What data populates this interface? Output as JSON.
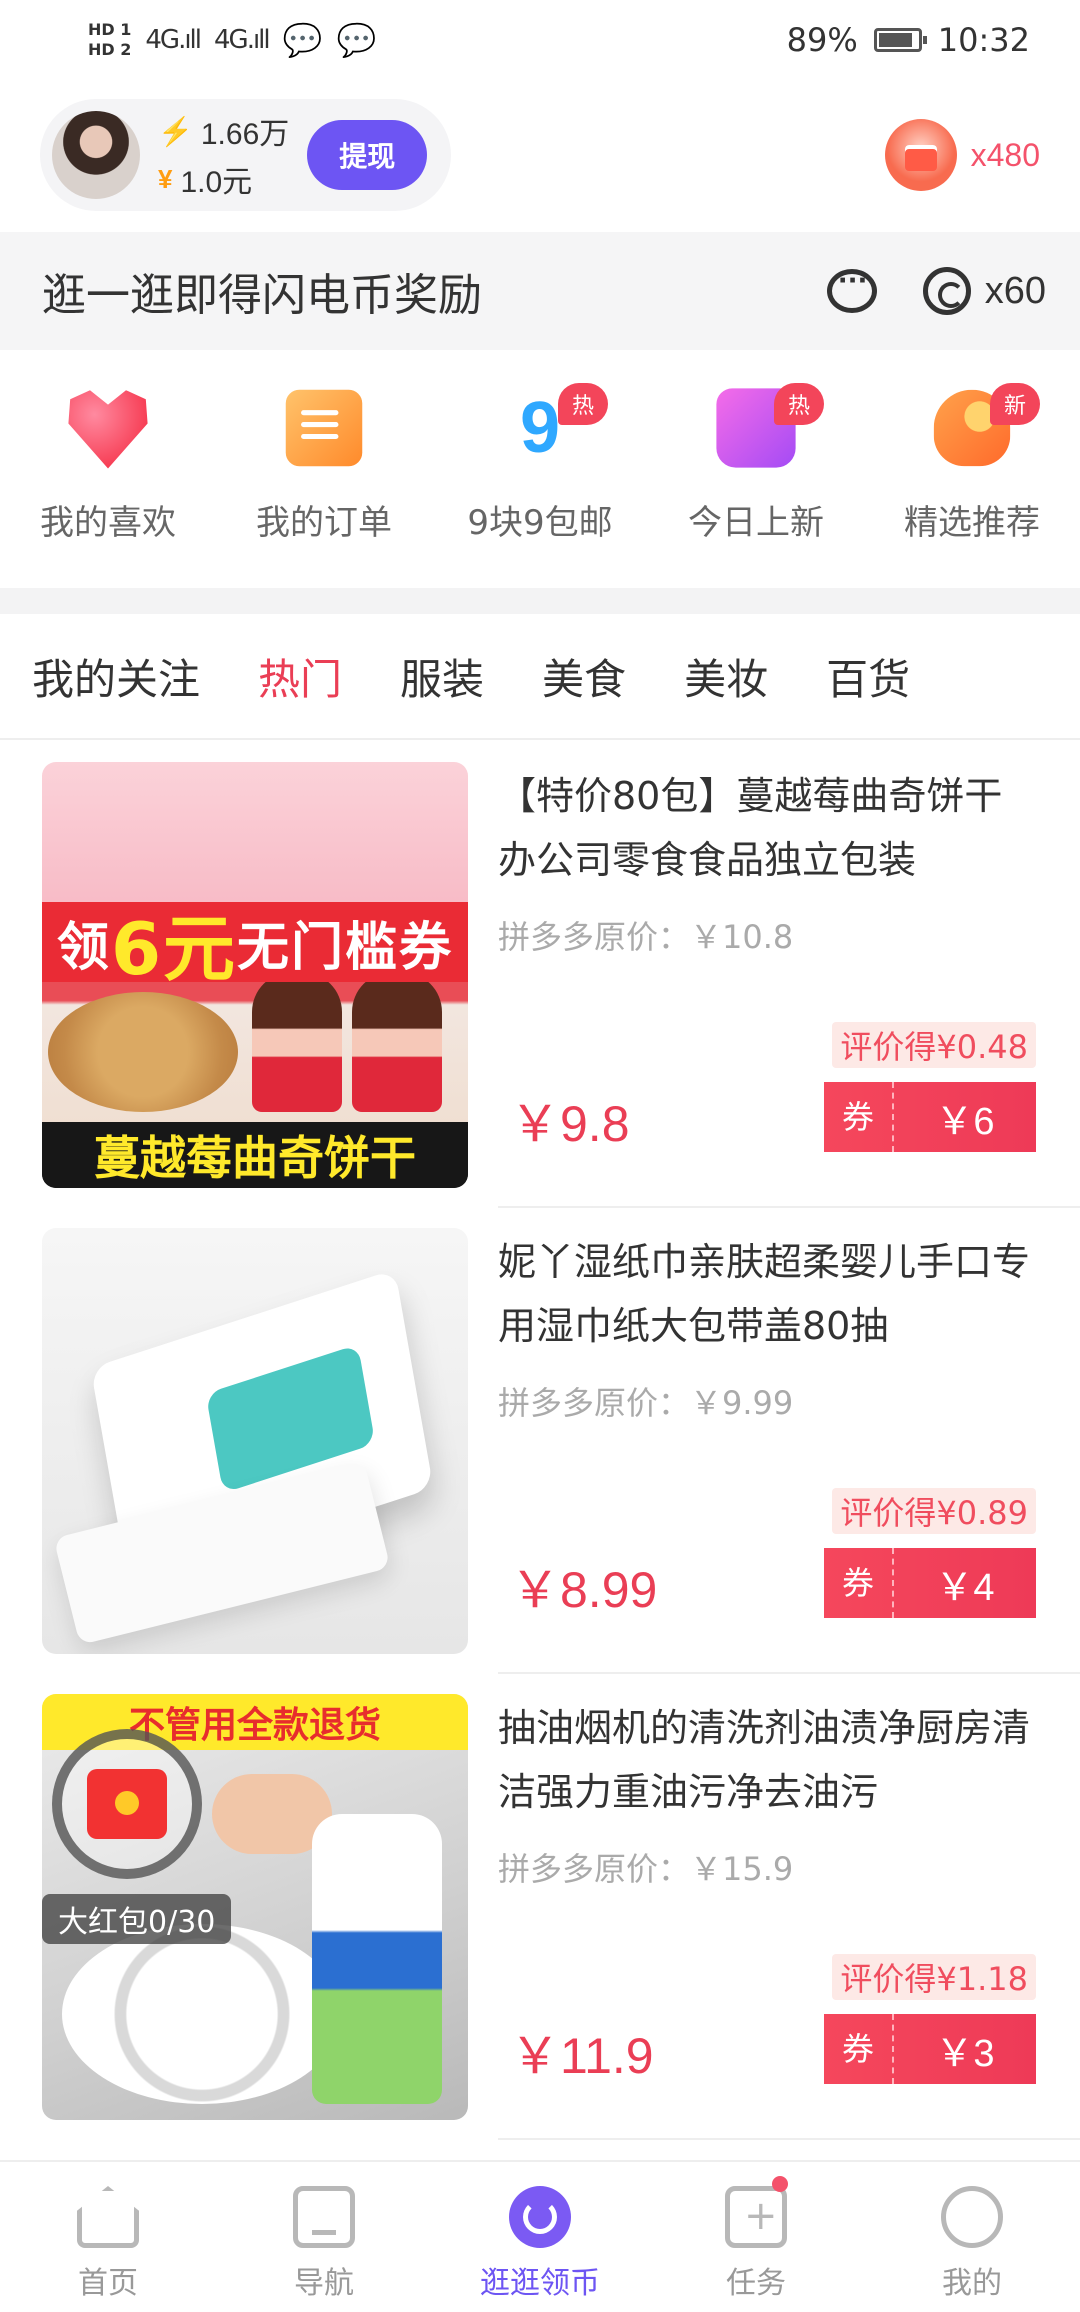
{
  "status_bar": {
    "hd1": "HD 1",
    "hd2": "HD 2",
    "signal1": "4G.ıll",
    "signal2": "4G.ıll",
    "battery": "89%",
    "time": "10:32"
  },
  "header": {
    "coins": "1.66万",
    "cash": "1.0元",
    "withdraw_label": "提现",
    "redpacket_count": "x480"
  },
  "banner": {
    "text": "逛一逛即得闪电币奖励",
    "timer": "x60"
  },
  "quick_menu": [
    {
      "label": "我的喜欢",
      "icon": "heart-icon",
      "badge": ""
    },
    {
      "label": "我的订单",
      "icon": "order-icon",
      "badge": ""
    },
    {
      "label": "9块9包邮",
      "icon": "nine-nine-icon",
      "badge": "热"
    },
    {
      "label": "今日上新",
      "icon": "new-arrival-icon",
      "badge": "热"
    },
    {
      "label": "精选推荐",
      "icon": "recommend-icon",
      "badge": "新"
    }
  ],
  "tabs": [
    "我的关注",
    "热门",
    "服装",
    "美食",
    "美妆",
    "百货"
  ],
  "active_tab": "热门",
  "products": [
    {
      "title": "【特价80包】蔓越莓曲奇饼干办公司零食食品独立包装",
      "original": "拼多多原价：￥10.8",
      "reward": "评价得¥0.48",
      "price": "￥9.8",
      "coupon_label": "券",
      "coupon_value": "￥6",
      "img_band_pre": "领",
      "img_band_big": "6元",
      "img_band_post": "无门槛券",
      "img_footer": "蔓越莓曲奇饼干"
    },
    {
      "title": "妮丫湿纸巾亲肤超柔婴儿手口专用湿巾纸大包带盖80抽",
      "original": "拼多多原价：￥9.99",
      "reward": "评价得¥0.89",
      "price": "￥8.99",
      "coupon_label": "券",
      "coupon_value": "￥4"
    },
    {
      "title": "抽油烟机的清洗剂油渍净厨房清洁强力重油污净去油污",
      "original": "拼多多原价：￥15.9",
      "reward": "评价得¥1.18",
      "price": "￥11.9",
      "coupon_label": "券",
      "coupon_value": "￥3",
      "img_top": "不管用全款退货",
      "redpack_label": "大红包0/30"
    }
  ],
  "bottom_nav": [
    {
      "label": "首页",
      "icon": "home-icon"
    },
    {
      "label": "导航",
      "icon": "guide-icon"
    },
    {
      "label": "逛逛领币",
      "icon": "stroll-coin-icon"
    },
    {
      "label": "任务",
      "icon": "task-icon"
    },
    {
      "label": "我的",
      "icon": "profile-icon"
    }
  ],
  "colors": {
    "accent_red": "#ea3e55",
    "accent_purple": "#6d55f3"
  }
}
